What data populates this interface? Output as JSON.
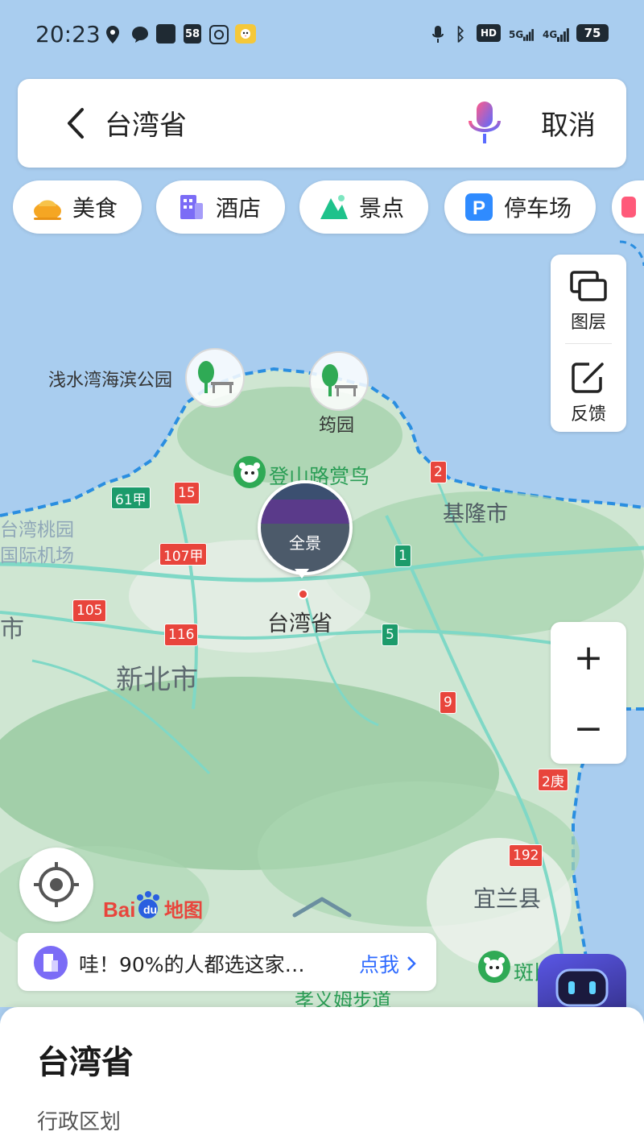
{
  "status_bar": {
    "time": "20:23",
    "battery": "75",
    "network_1": "5G",
    "network_2": "4G",
    "hd": "HD",
    "app_badge": "58"
  },
  "search": {
    "query": "台湾省",
    "cancel_label": "取消"
  },
  "categories": [
    {
      "label": "美食",
      "icon": "food-icon",
      "color": "#f5a623"
    },
    {
      "label": "酒店",
      "icon": "hotel-icon",
      "color": "#7b6cf6"
    },
    {
      "label": "景点",
      "icon": "scenic-icon",
      "color": "#1ec28b"
    },
    {
      "label": "停车场",
      "icon": "parking-icon",
      "color": "#2f8bff"
    }
  ],
  "side_panel": {
    "layers_label": "图层",
    "feedback_label": "反馈"
  },
  "map": {
    "labels": {
      "park_1": "浅水湾海滨公园",
      "park_2": "筠园",
      "trail": "登山路赏鸟",
      "keelung": "基隆市",
      "airport_1": "台湾桃园",
      "airport_2": "国际机场",
      "city_cut": "市",
      "center": "台湾省",
      "new_taipei": "新北市",
      "yilan": "宜兰县",
      "bottom_trail": "孝义姆步道",
      "panda_poi": "斑比山丘"
    },
    "roads": [
      {
        "label": "61甲",
        "color": "green"
      },
      {
        "label": "15",
        "color": "red"
      },
      {
        "label": "2",
        "color": "red"
      },
      {
        "label": "107甲",
        "color": "red"
      },
      {
        "label": "1",
        "color": "green"
      },
      {
        "label": "105",
        "color": "red"
      },
      {
        "label": "116",
        "color": "red"
      },
      {
        "label": "5",
        "color": "green"
      },
      {
        "label": "9",
        "color": "red"
      },
      {
        "label": "2庚",
        "color": "red"
      },
      {
        "label": "192",
        "color": "red"
      }
    ],
    "pano_label": "全景",
    "logo_text": "Bai地图"
  },
  "zoom": {
    "plus": "+",
    "minus": "−"
  },
  "promo": {
    "text": "哇！90%的人都选这家…",
    "link": "点我"
  },
  "sheet": {
    "title": "台湾省",
    "subtitle": "行政区划"
  }
}
